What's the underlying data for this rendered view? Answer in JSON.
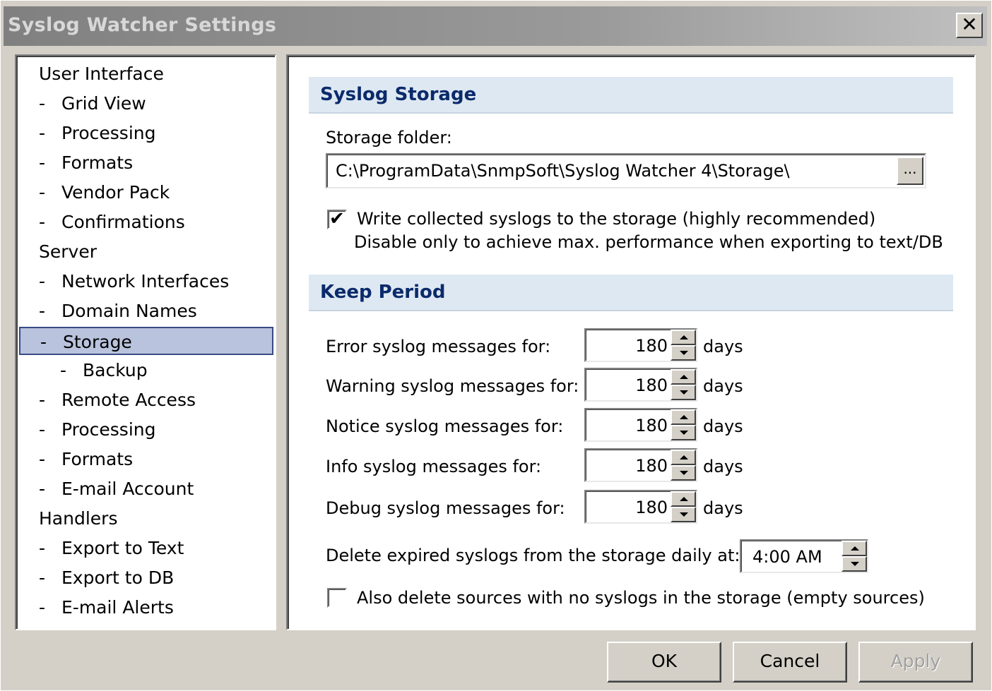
{
  "window": {
    "title": "Syslog Watcher Settings",
    "close_label": "✕"
  },
  "tree": {
    "items": [
      {
        "label": "User Interface",
        "level": "root"
      },
      {
        "label": "Grid View",
        "level": "child"
      },
      {
        "label": "Processing",
        "level": "child"
      },
      {
        "label": "Formats",
        "level": "child"
      },
      {
        "label": "Vendor Pack",
        "level": "child"
      },
      {
        "label": "Confirmations",
        "level": "child"
      },
      {
        "label": "Server",
        "level": "root"
      },
      {
        "label": "Network Interfaces",
        "level": "child"
      },
      {
        "label": "Domain Names",
        "level": "child"
      },
      {
        "label": "Storage",
        "level": "child",
        "selected": true
      },
      {
        "label": "Backup",
        "level": "grand"
      },
      {
        "label": "Remote Access",
        "level": "child"
      },
      {
        "label": "Processing",
        "level": "child"
      },
      {
        "label": "Formats",
        "level": "child"
      },
      {
        "label": "E-mail Account",
        "level": "child"
      },
      {
        "label": "Handlers",
        "level": "root"
      },
      {
        "label": "Export to Text",
        "level": "child"
      },
      {
        "label": "Export to DB",
        "level": "child"
      },
      {
        "label": "E-mail Alerts",
        "level": "child"
      }
    ],
    "dash": "-"
  },
  "storage": {
    "header": "Syslog Storage",
    "folder_label": "Storage folder:",
    "folder_value": "C:\\ProgramData\\SnmpSoft\\Syslog Watcher 4\\Storage\\",
    "browse_label": "...",
    "write_checked": true,
    "write_label": "Write collected syslogs to the storage (highly recommended)",
    "write_note": "Disable only to achieve max. performance when exporting to text/DB"
  },
  "keep": {
    "header": "Keep Period",
    "unit": "days",
    "rows": [
      {
        "label": "Error syslog messages for:",
        "value": "180"
      },
      {
        "label": "Warning syslog messages for:",
        "value": "180"
      },
      {
        "label": "Notice syslog messages for:",
        "value": "180"
      },
      {
        "label": "Info syslog messages for:",
        "value": "180"
      },
      {
        "label": "Debug syslog messages for:",
        "value": "180"
      }
    ],
    "delete_label": "Delete expired syslogs from the storage daily at:",
    "delete_time": "4:00 AM",
    "empty_checked": false,
    "empty_label": "Also delete sources with no syslogs in the storage (empty sources)"
  },
  "buttons": {
    "ok": "OK",
    "cancel": "Cancel",
    "apply": "Apply"
  },
  "check_glyph": "✔"
}
